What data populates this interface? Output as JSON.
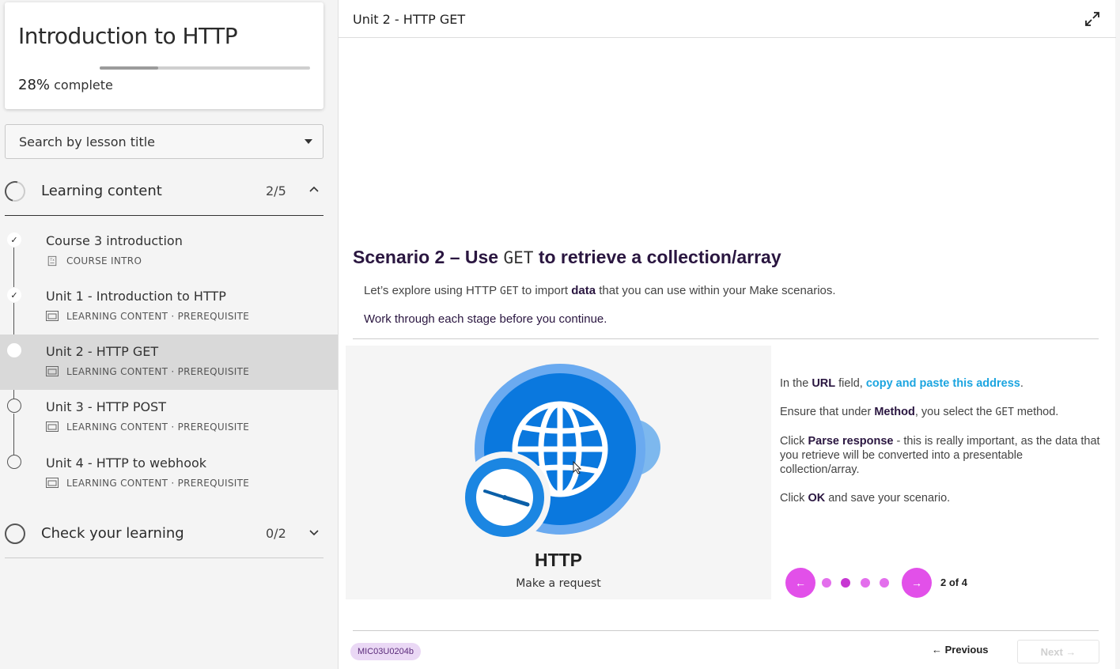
{
  "course": {
    "title": "Introduction to HTTP",
    "progress_percent": 28,
    "progress_value": "28%",
    "progress_suffix": "complete"
  },
  "search": {
    "label": "Search by lesson title",
    "icon": "caret-down-icon"
  },
  "sections": [
    {
      "title": "Learning content",
      "count": "2/5",
      "expanded": true,
      "icon": "chevron-up-icon",
      "lessons": [
        {
          "title": "Course 3 introduction",
          "meta": "COURSE INTRO",
          "status": "done",
          "icon": "document-icon"
        },
        {
          "title": "Unit 1 - Introduction to HTTP",
          "meta": "LEARNING CONTENT · PREREQUISITE",
          "status": "done",
          "icon": "slides-icon"
        },
        {
          "title": "Unit 2 - HTTP GET",
          "meta": "LEARNING CONTENT · PREREQUISITE",
          "status": "current",
          "icon": "slides-icon"
        },
        {
          "title": "Unit 3 - HTTP POST",
          "meta": "LEARNING CONTENT · PREREQUISITE",
          "status": "todo",
          "icon": "slides-icon"
        },
        {
          "title": "Unit 4 - HTTP to webhook",
          "meta": "LEARNING CONTENT · PREREQUISITE",
          "status": "todo",
          "icon": "slides-icon"
        }
      ]
    },
    {
      "title": "Check your learning",
      "count": "0/2",
      "expanded": false,
      "icon": "chevron-down-icon"
    }
  ],
  "main": {
    "title": "Unit 2 - HTTP GET",
    "expand_icon": "expand-icon",
    "scenario": {
      "title_prefix": "Scenario 2 – Use ",
      "title_code": "GET",
      "title_suffix": " to retrieve a collection/array",
      "intro_1": "Let’s explore using HTTP ",
      "intro_code": "GET",
      "intro_2": " to import ",
      "intro_bold": "data",
      "intro_3": " that you can use within your Make scenarios.",
      "work": "Work through each stage before you continue."
    },
    "graphic": {
      "label": "HTTP",
      "sublabel": "Make a request"
    },
    "steps": {
      "s1_a": "In the ",
      "s1_b": "URL",
      "s1_c": " field, ",
      "s1_link": "copy and paste this address",
      "s1_d": ".",
      "s2_a": "Ensure that under ",
      "s2_b": "Method",
      "s2_c": ", you select the ",
      "s2_code": "GET",
      "s2_d": " method.",
      "s3_a": "Click ",
      "s3_b": "Parse response",
      "s3_c": " - this is really important, as the data that you retrieve will be converted into a presentable collection/array.",
      "s4_a": "Click ",
      "s4_b": "OK",
      "s4_c": " and save your scenario."
    },
    "carousel": {
      "prev_icon": "arrow-left-icon",
      "next_icon": "arrow-right-icon",
      "current": 2,
      "total": 4,
      "count_text": "2 of 4"
    },
    "footer": {
      "code": "MIC03U0204b",
      "previous": "← Previous",
      "next": "Next →"
    }
  },
  "colors": {
    "accent": "#e250e9",
    "link": "#1ca5e0",
    "heading": "#2a1640",
    "http_blue": "#0a78de"
  }
}
